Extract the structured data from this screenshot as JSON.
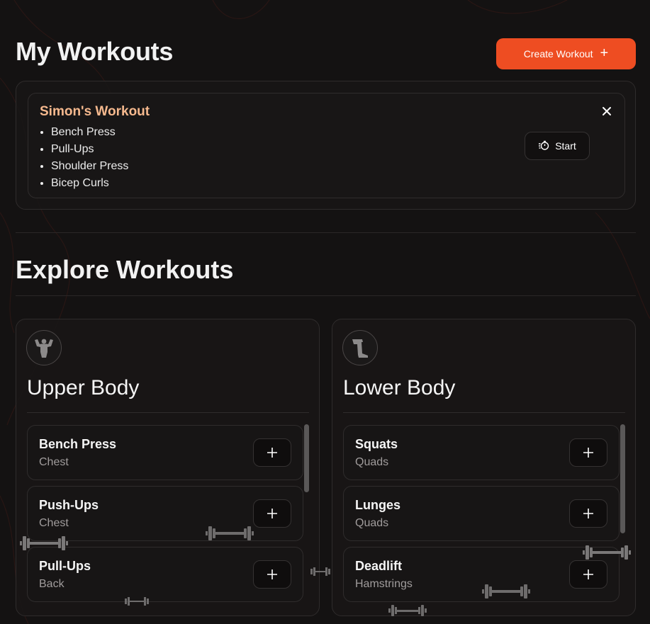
{
  "header": {
    "title": "My Workouts",
    "create_label": "Create Workout"
  },
  "my_workouts": [
    {
      "title": "Simon's Workout",
      "exercises": [
        "Bench Press",
        "Pull-Ups",
        "Shoulder Press",
        "Bicep Curls"
      ],
      "start_label": "Start"
    }
  ],
  "explore": {
    "title": "Explore Workouts",
    "categories": [
      {
        "title": "Upper Body",
        "icon": "flexing-torso-icon",
        "exercises": [
          {
            "name": "Bench Press",
            "muscle": "Chest"
          },
          {
            "name": "Push-Ups",
            "muscle": "Chest"
          },
          {
            "name": "Pull-Ups",
            "muscle": "Back"
          }
        ]
      },
      {
        "title": "Lower Body",
        "icon": "leg-icon",
        "exercises": [
          {
            "name": "Squats",
            "muscle": "Quads"
          },
          {
            "name": "Lunges",
            "muscle": "Quads"
          },
          {
            "name": "Deadlift",
            "muscle": "Hamstrings"
          }
        ]
      }
    ]
  },
  "colors": {
    "accent": "#ee4d22",
    "workout_title": "#f6b98e",
    "background": "#141212"
  }
}
